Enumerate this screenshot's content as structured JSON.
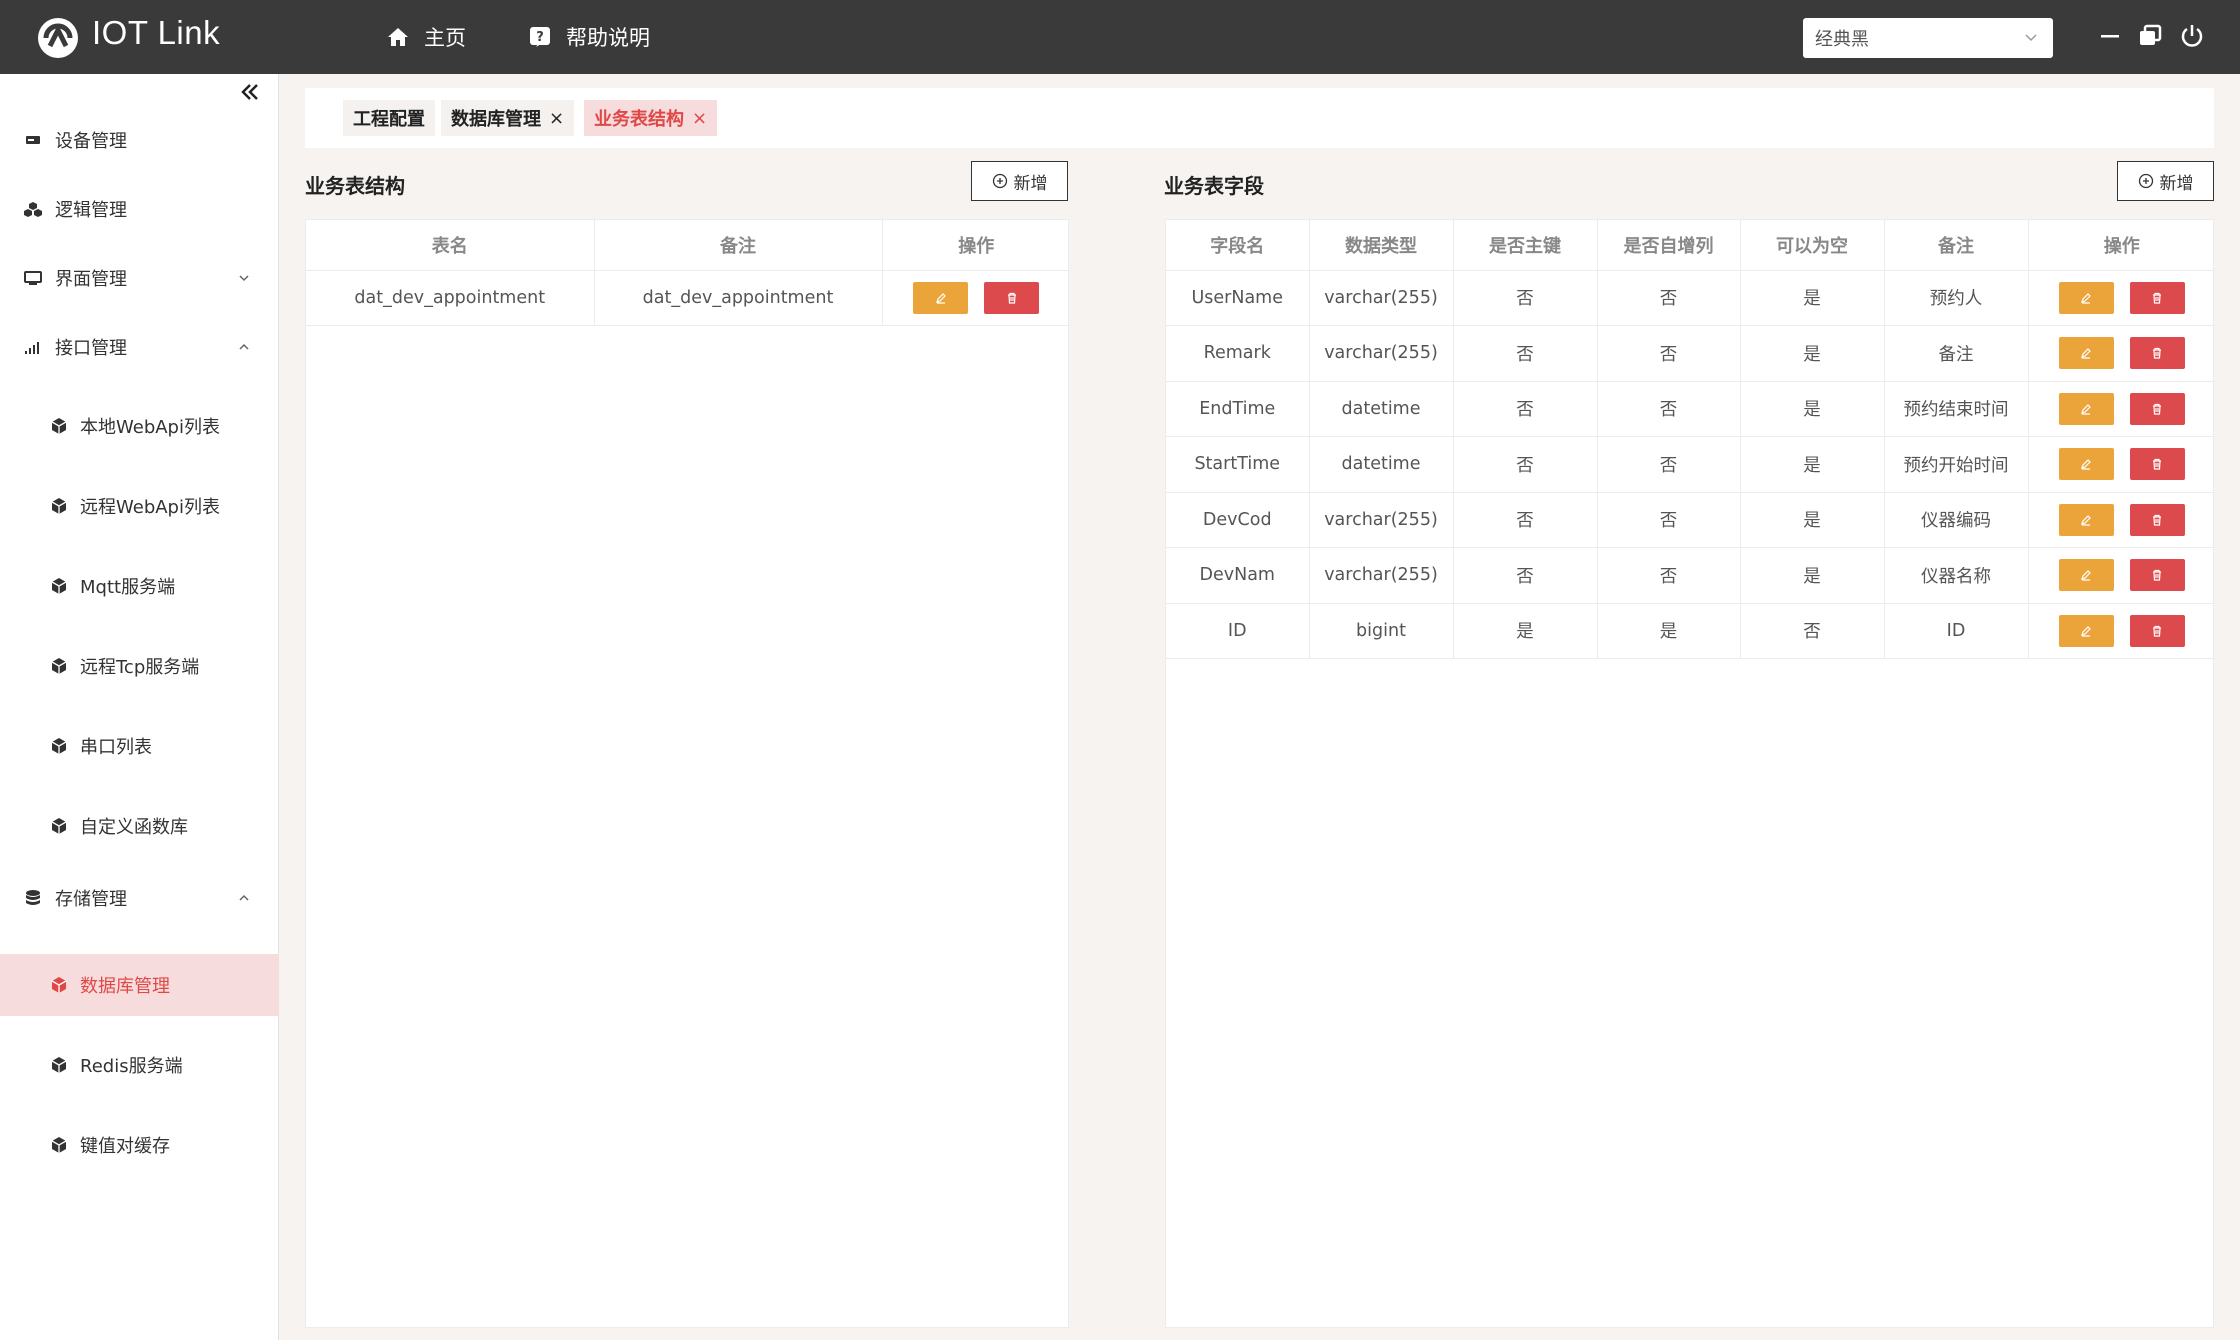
{
  "header": {
    "app_title": "IOT Link",
    "nav": [
      {
        "label": "主页",
        "icon": "home-icon"
      },
      {
        "label": "帮助说明",
        "icon": "help-icon"
      }
    ],
    "theme_select": {
      "value": "经典黑"
    }
  },
  "sidebar": {
    "items": [
      {
        "label": "设备管理",
        "icon": "device-icon"
      },
      {
        "label": "逻辑管理",
        "icon": "logic-icon"
      },
      {
        "label": "界面管理",
        "icon": "monitor-icon",
        "expanded": false
      },
      {
        "label": "接口管理",
        "icon": "signal-icon",
        "expanded": true
      },
      {
        "label": "本地WebApi列表",
        "icon": "cube-icon"
      },
      {
        "label": "远程WebApi列表",
        "icon": "cube-icon"
      },
      {
        "label": "Mqtt服务端",
        "icon": "cube-icon"
      },
      {
        "label": "远程Tcp服务端",
        "icon": "cube-icon"
      },
      {
        "label": "串口列表",
        "icon": "cube-icon"
      },
      {
        "label": "自定义函数库",
        "icon": "cube-icon"
      },
      {
        "label": "存储管理",
        "icon": "database-icon",
        "expanded": true
      },
      {
        "label": "数据库管理",
        "icon": "cube-icon",
        "active": true
      },
      {
        "label": "Redis服务端",
        "icon": "cube-icon"
      },
      {
        "label": "键值对缓存",
        "icon": "cube-icon"
      }
    ]
  },
  "tabs": [
    {
      "label": "工程配置",
      "closable": false
    },
    {
      "label": "数据库管理",
      "closable": true,
      "close": "×"
    },
    {
      "label": "业务表结构",
      "closable": true,
      "close": "×",
      "active": true
    }
  ],
  "left_panel": {
    "title": "业务表结构",
    "add_label": "新增",
    "columns": [
      "表名",
      "备注",
      "操作"
    ],
    "rows": [
      [
        "dat_dev_appointment",
        "dat_dev_appointment"
      ]
    ]
  },
  "right_panel": {
    "title": "业务表字段",
    "add_label": "新增",
    "columns": [
      "字段名",
      "数据类型",
      "是否主键",
      "是否自增列",
      "可以为空",
      "备注",
      "操作"
    ],
    "rows": [
      [
        "UserName",
        "varchar(255)",
        "否",
        "否",
        "是",
        "预约人"
      ],
      [
        "Remark",
        "varchar(255)",
        "否",
        "否",
        "是",
        "备注"
      ],
      [
        "EndTime",
        "datetime",
        "否",
        "否",
        "是",
        "预约结束时间"
      ],
      [
        "StartTime",
        "datetime",
        "否",
        "否",
        "是",
        "预约开始时间"
      ],
      [
        "DevCod",
        "varchar(255)",
        "否",
        "否",
        "是",
        "仪器编码"
      ],
      [
        "DevNam",
        "varchar(255)",
        "否",
        "否",
        "是",
        "仪器名称"
      ],
      [
        "ID",
        "bigint",
        "是",
        "是",
        "否",
        "ID"
      ]
    ]
  },
  "colors": {
    "header_bg": "#3a3a3a",
    "accent_red": "#e04848",
    "active_bg": "#f6dcdc",
    "edit_button": "#eba43a",
    "delete_button": "#dd4a4d"
  }
}
